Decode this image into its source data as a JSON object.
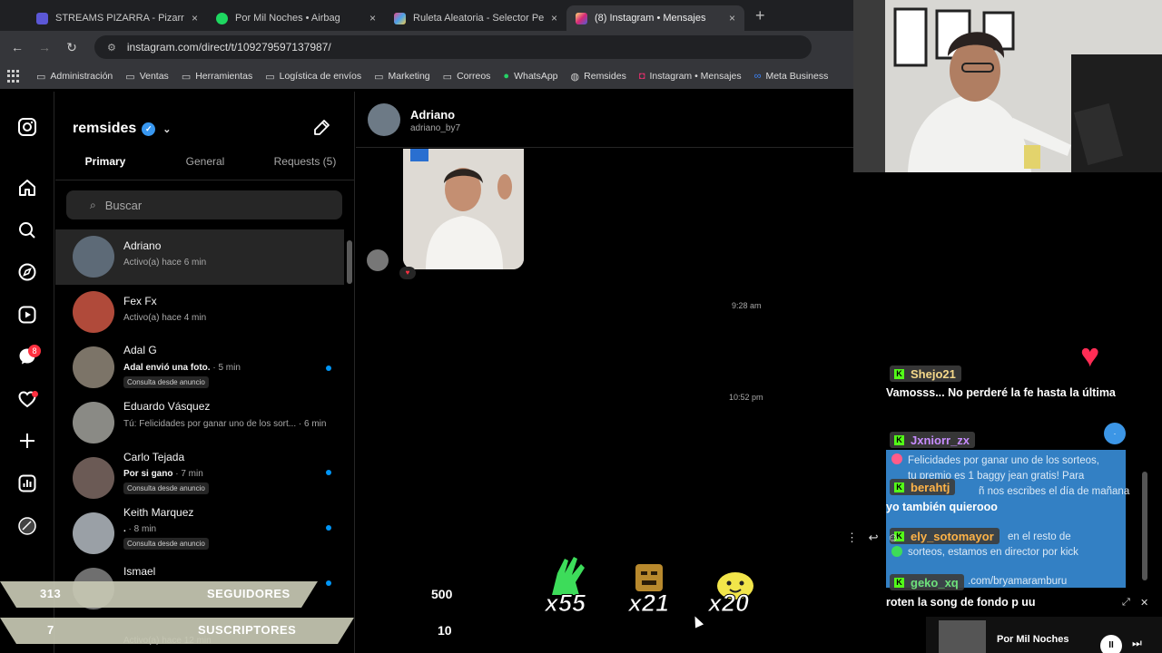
{
  "browser": {
    "tabs": [
      {
        "title": "STREAMS PIZARRA - Pizarra on",
        "color": "#5b57d6",
        "active": false,
        "close": "×"
      },
      {
        "title": "Por Mil Noches • Airbag",
        "color": "#1ed760",
        "active": false,
        "close": "×"
      },
      {
        "title": "Ruleta Aleatoria - Selector Pers",
        "color": "#e94b8a",
        "active": false,
        "close": "×"
      },
      {
        "title": "(8) Instagram • Mensajes",
        "color": "#d62976",
        "active": true,
        "close": "×"
      }
    ],
    "new_tab": "+",
    "url": "instagram.com/direct/t/109279597137987/",
    "bookmarks": [
      {
        "label": "Administración",
        "icon": "folder-icon"
      },
      {
        "label": "Ventas",
        "icon": "folder-icon"
      },
      {
        "label": "Herramientas",
        "icon": "folder-icon"
      },
      {
        "label": "Logística de envíos",
        "icon": "folder-icon"
      },
      {
        "label": "Marketing",
        "icon": "folder-icon"
      },
      {
        "label": "Correos",
        "icon": "folder-icon"
      },
      {
        "label": "WhatsApp",
        "icon": "whatsapp-icon"
      },
      {
        "label": "Remsides",
        "icon": "globe-icon"
      },
      {
        "label": "Instagram • Mensajes",
        "icon": "instagram-icon"
      },
      {
        "label": "Meta Business",
        "icon": "meta-icon"
      }
    ]
  },
  "rail": {
    "notification_count": "8"
  },
  "inbox": {
    "account": "remsides",
    "tabs": [
      "Primary",
      "General",
      "Requests (5)"
    ],
    "search_placeholder": "Buscar",
    "threads": [
      {
        "name": "Adriano",
        "preview": "Activo(a) hace 6 min",
        "time": "",
        "tag": "",
        "unread": false,
        "bold": false,
        "selected": true,
        "avatar_color": "#5d6a77"
      },
      {
        "name": "Fex Fx",
        "preview": "Activo(a) hace 4 min",
        "time": "",
        "tag": "",
        "unread": false,
        "bold": false,
        "selected": false,
        "avatar_color": "#b04a3a"
      },
      {
        "name": "Adal G",
        "preview": "Adal envió una foto.",
        "time": " · 5 min",
        "tag": "Consulta desde anuncio",
        "unread": true,
        "bold": true,
        "selected": false,
        "avatar_color": "#7c7468"
      },
      {
        "name": "Eduardo Vásquez",
        "preview": "Tú: Felicidades por ganar uno de los sort...",
        "time": " · 6 min",
        "tag": "",
        "unread": false,
        "bold": false,
        "selected": false,
        "avatar_color": "#8a8a85"
      },
      {
        "name": "Carlo Tejada",
        "preview": "Por si gano",
        "time": " · 7 min",
        "tag": "Consulta desde anuncio",
        "unread": true,
        "bold": true,
        "selected": false,
        "avatar_color": "#6b5a55"
      },
      {
        "name": "Keith Marquez",
        "preview": ".",
        "time": " · 8 min",
        "tag": "Consulta desde anuncio",
        "unread": true,
        "bold": true,
        "selected": false,
        "avatar_color": "#9aa0a6"
      },
      {
        "name": "Ismael",
        "preview": "Activo(a) hace 12 min",
        "time": "",
        "tag": "",
        "unread": true,
        "bold": false,
        "selected": false,
        "avatar_color": "#6f6f6f"
      }
    ]
  },
  "conversation": {
    "name": "Adriano",
    "username": "adriano_by7",
    "reaction": "♥",
    "timestamps": [
      "9:28 am",
      "10:52 pm"
    ]
  },
  "stream_overlay": {
    "followers_count": "313",
    "followers_label": "SEGUIDORES",
    "subscribers_count": "7",
    "subscribers_label": "SUSCRIPTORES",
    "goal_top": "500",
    "goal_bottom": "10",
    "emote_multipliers": [
      "x55",
      "x21",
      "x20"
    ]
  },
  "chat": {
    "messages": [
      {
        "user": "Shejo21",
        "user_color": "#f5d88a",
        "text": "Vamosss... No perderé la fe hasta la última"
      },
      {
        "user": "Jxniorr_zx",
        "user_color": "#c78cff",
        "text": ""
      },
      {
        "user": "berahtj",
        "user_color": "#ffb347",
        "text": "yo también quierooo"
      },
      {
        "user": "ely_sotomayor",
        "user_color": "#ffb347",
        "text": ""
      },
      {
        "user": "geko_xq",
        "user_color": "#6ee07a",
        "text": "roten la song de fondo p uu"
      }
    ],
    "popup_lines": [
      "Felicidades por ganar uno de los sorteos,",
      "tu premio es 1 baggy jean gratis! Para",
      "ñ nos escribes el día de mañana",
      "en el resto de",
      "sorteos, estamos en director por kick",
      ".com/bryamaramburu"
    ],
    "player": {
      "title": "Por Mil Noches",
      "pause": "II",
      "next": "⏭"
    }
  }
}
